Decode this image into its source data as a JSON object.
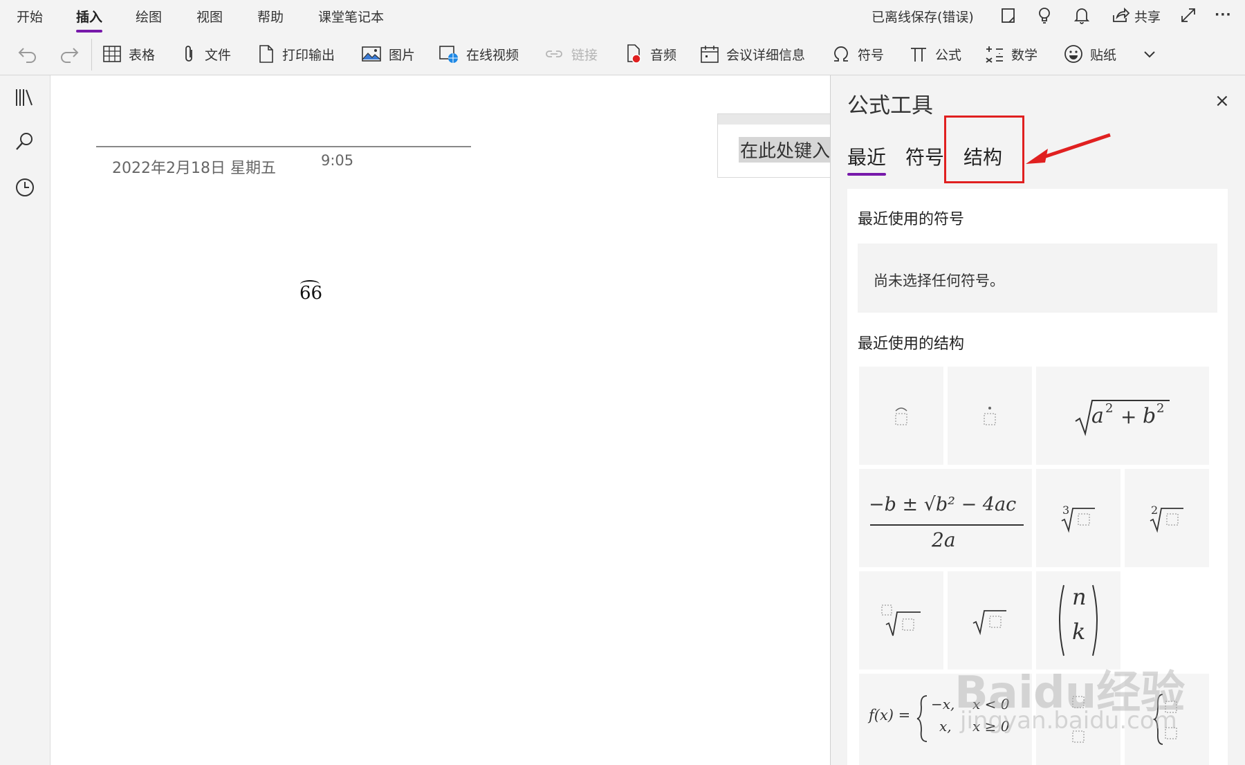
{
  "ribbon": {
    "tabs": [
      "开始",
      "插入",
      "绘图",
      "视图",
      "帮助",
      "课堂笔记本"
    ],
    "active_tab": "插入",
    "status": "已离线保存(错误)",
    "share_label": "共享",
    "more": "···"
  },
  "toolbar": {
    "table": "表格",
    "file": "文件",
    "printout": "打印输出",
    "picture": "图片",
    "online_video": "在线视频",
    "link": "链接",
    "audio": "音频",
    "meeting": "会议详细信息",
    "symbol": "符号",
    "equation": "公式",
    "math": "数学",
    "sticker": "贴纸"
  },
  "page": {
    "date": "2022年2月18日 星期五",
    "time": "9:05",
    "container_placeholder": "在此处键入",
    "math_text": "66"
  },
  "formula_panel": {
    "title": "公式工具",
    "close": "×",
    "tabs": [
      "最近",
      "符号",
      "结构"
    ],
    "active_tab": "最近",
    "highlighted_tab": "结构",
    "recent_symbols_heading": "最近使用的符号",
    "no_symbols_text": "尚未选择任何符号。",
    "recent_structures_heading": "最近使用的结构",
    "structures": [
      "arc-accent",
      "dot-accent",
      "sqrt-a2-b2",
      "quadratic-formula",
      "cube-root",
      "square-root-index-2",
      "nth-root",
      "square-root",
      "binomial-n-k",
      "piecewise-function",
      "vertical-stack",
      "left-brace-stack"
    ],
    "sqrt_a2b2": {
      "a": "a",
      "b": "b",
      "exp": "2",
      "plus": "+"
    },
    "quadratic": {
      "numerator": "−b ± √b² − 4ac",
      "denominator": "2a"
    },
    "binomial": {
      "top": "n",
      "bottom": "k"
    },
    "cube_index": "3",
    "sq_index": "2",
    "piecewise": {
      "lhs": "f(x) =",
      "row1_expr": "−x,",
      "row1_cond": "x < 0",
      "row2_expr": "x,",
      "row2_cond": "x ≥ 0"
    }
  },
  "watermark": {
    "main": "Baidu经验",
    "sub": "jingyan.baidu.com"
  },
  "colors": {
    "accent": "#7719aa",
    "highlight": "#e02020"
  }
}
